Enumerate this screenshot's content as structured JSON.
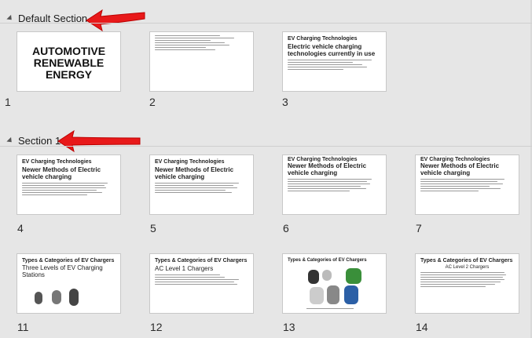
{
  "sections": [
    {
      "name": "Default Section"
    },
    {
      "name": "Section 1"
    }
  ],
  "slides": [
    {
      "number": "1",
      "title": "AUTOMOTIVE RENEWABLE ENERGY"
    },
    {
      "number": "2"
    },
    {
      "number": "3",
      "title": "EV Charging Technologies",
      "subtitle": "Electric vehicle charging technologies currently in use"
    },
    {
      "number": "4",
      "title": "EV Charging Technologies",
      "subtitle": "Newer Methods of Electric vehicle charging"
    },
    {
      "number": "5",
      "title": "EV Charging Technologies",
      "subtitle": "Newer Methods of Electric vehicle charging"
    },
    {
      "number": "6",
      "title": "EV Charging Technologies",
      "subtitle": "Newer Methods of Electric vehicle charging"
    },
    {
      "number": "7",
      "title": "EV Charging Technologies",
      "subtitle": "Newer Methods of Electric vehicle charging"
    },
    {
      "number": "11",
      "title": "Types & Categories of EV Chargers",
      "subtitle": "Three Levels of EV Charging Stations"
    },
    {
      "number": "12",
      "title": "Types & Categories of EV Chargers",
      "subtitle": "AC Level 1 Chargers"
    },
    {
      "number": "13",
      "title": "Types & Categories of EV Chargers"
    },
    {
      "number": "14",
      "title": "Types & Categories of EV Chargers",
      "subtitle": "AC Level 2 Chargers"
    }
  ],
  "colors": {
    "arrow": "#e8191a",
    "background": "#e6e6e6"
  }
}
